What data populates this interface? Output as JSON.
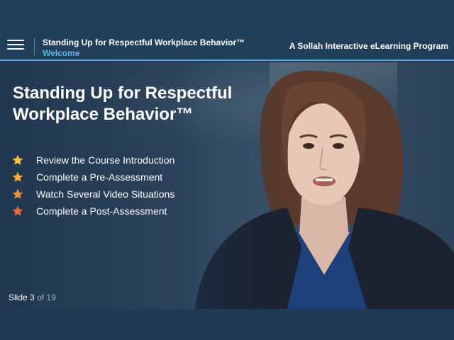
{
  "header": {
    "course_title": "Standing Up for Respectful Workplace Behavior™",
    "section_title": "Welcome",
    "brand": "A Sollah Interactive eLearning Program",
    "menu_icon": "hamburger-menu-icon"
  },
  "hero": {
    "title_line1": "Standing Up for Respectful",
    "title_line2": "Workplace Behavior™"
  },
  "objectives": [
    {
      "label": "Review the Course Introduction",
      "icon": "star-icon",
      "color": "#f7c23d"
    },
    {
      "label": "Complete a Pre-Assessment",
      "icon": "star-icon",
      "color": "#f5aa3a"
    },
    {
      "label": "Watch Several Video Situations",
      "icon": "star-icon",
      "color": "#ef8c3c"
    },
    {
      "label": "Complete a Post-Assessment",
      "icon": "star-icon",
      "color": "#e86b3e"
    }
  ],
  "slide": {
    "prefix": "Slide",
    "current": "3",
    "of_label": "of",
    "total": "19"
  },
  "colors": {
    "header_bg": "#223f5a",
    "accent": "#56b8e8",
    "footer_bg": "#1f3a52"
  }
}
